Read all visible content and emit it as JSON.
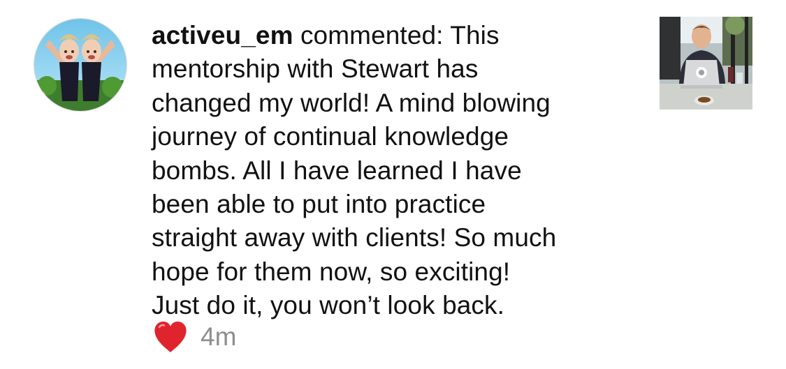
{
  "comment": {
    "username": "activeu_em",
    "action": " commented: ",
    "body": "This\nmentorship with Stewart has\nchanged my world! A mind blowing\njourney of continual  knowledge\nbombs. All I have learned  I have\nbeen able to put into practice\nstraight away with clients!  So much\nhope for them now, so exciting!\nJust do it, you won’t look back.",
    "timestamp": "4m",
    "liked": true
  },
  "avatar": {
    "icon": "profile-avatar"
  },
  "post": {
    "icon": "post-thumbnail"
  },
  "colors": {
    "heart": "#e0242e",
    "timestamp": "#8e8e8e",
    "text": "#111111"
  }
}
